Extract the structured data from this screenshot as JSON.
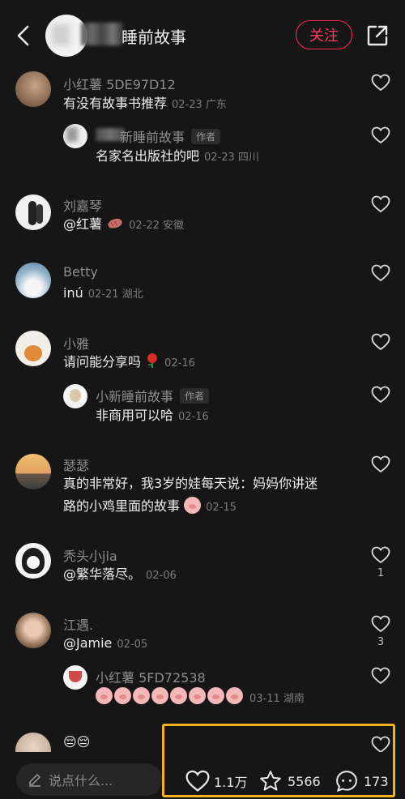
{
  "header": {
    "title": "睡前故事",
    "follow_label": "关注"
  },
  "comments": [
    {
      "name": "小红薯 5DE97D12",
      "text": "有没有故事书推荐",
      "meta": "02-23 广东"
    },
    {
      "name": "新睡前故事",
      "badge": "作者",
      "text": "名家名出版社的吧",
      "meta": "02-23 四川"
    },
    {
      "name": "刘嘉琴",
      "text": "@红薯",
      "meta": "02-22 安徽"
    },
    {
      "name": "Betty",
      "text": "inú",
      "meta": "02-21 湖北"
    },
    {
      "name": "小雅",
      "text": "请问能分享吗",
      "meta": "02-16"
    },
    {
      "name": "小新睡前故事",
      "badge": "作者",
      "text": "非商用可以哈",
      "meta": "02-16"
    },
    {
      "name": "瑟瑟",
      "text1": "真的非常好，我3岁的娃每天说：妈妈你讲迷",
      "text2": "路的小鸡里面的故事",
      "meta": "02-15"
    },
    {
      "name": "秃头小jia",
      "text": "@繁华落尽。",
      "meta": "02-06",
      "likes": "1"
    },
    {
      "name": "江遇.",
      "text": "@Jamie",
      "meta": "02-05",
      "likes": "3"
    },
    {
      "name": "小红薯 5FD72538",
      "meta": "03-11 湖南"
    },
    {
      "text": "😔😔"
    }
  ],
  "bottom": {
    "placeholder": "说点什么...",
    "likes": "1.1万",
    "stars": "5566",
    "comments": "173"
  },
  "icons": [
    "back-icon",
    "share-icon",
    "heart-icon",
    "star-icon",
    "comment-icon",
    "pencil-icon",
    "rose-icon"
  ]
}
